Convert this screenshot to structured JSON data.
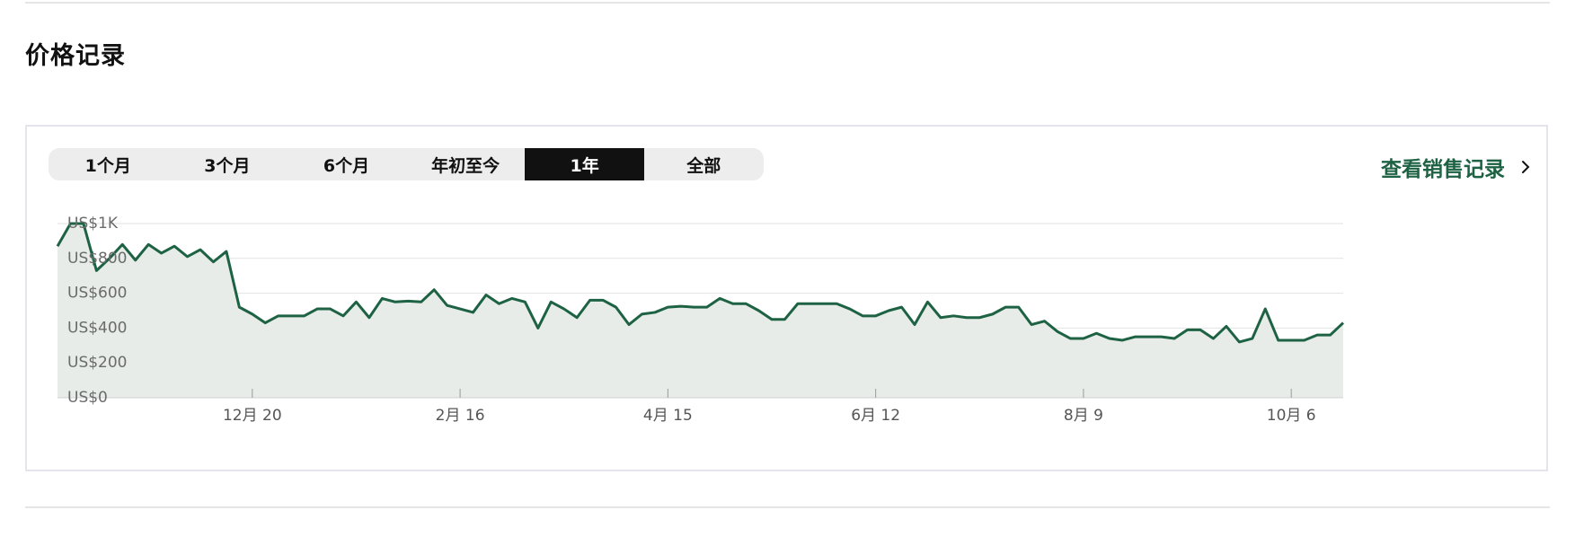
{
  "section": {
    "title": "价格记录"
  },
  "tabs": [
    "1个月",
    "3个月",
    "6个月",
    "年初至今",
    "1年",
    "全部"
  ],
  "active_tab": "1年",
  "sales_link": {
    "label": "查看销售记录",
    "icon": "chevron-right-icon"
  },
  "colors": {
    "line": "#1e6244",
    "area": "#e7ece9",
    "grid": "#e2e2e2",
    "link": "#1e6244",
    "active_tab_bg": "#111111"
  },
  "chart_data": {
    "type": "area",
    "y_ticks": [
      {
        "value": 0,
        "label": "US$0"
      },
      {
        "value": 200,
        "label": "US$200"
      },
      {
        "value": 400,
        "label": "US$400"
      },
      {
        "value": 600,
        "label": "US$600"
      },
      {
        "value": 800,
        "label": "US$800"
      },
      {
        "value": 1000,
        "label": "US$1K"
      }
    ],
    "ylim": [
      0,
      1000
    ],
    "x_ticks": [
      {
        "index": 15,
        "label": "12月 20"
      },
      {
        "index": 31,
        "label": "2月 16"
      },
      {
        "index": 47,
        "label": "4月 15"
      },
      {
        "index": 63,
        "label": "6月 12"
      },
      {
        "index": 79,
        "label": "8月 9"
      },
      {
        "index": 95,
        "label": "10月 6"
      }
    ],
    "xlim": [
      0,
      100
    ],
    "grid": true,
    "values": [
      870,
      1000,
      1000,
      730,
      800,
      880,
      790,
      880,
      830,
      870,
      810,
      850,
      780,
      840,
      520,
      480,
      430,
      470,
      470,
      470,
      510,
      510,
      470,
      550,
      460,
      570,
      550,
      555,
      550,
      620,
      530,
      510,
      490,
      590,
      540,
      570,
      550,
      400,
      550,
      510,
      460,
      560,
      560,
      520,
      420,
      480,
      490,
      520,
      525,
      520,
      520,
      570,
      540,
      540,
      500,
      450,
      450,
      540,
      540,
      540,
      540,
      510,
      470,
      470,
      500,
      520,
      420,
      550,
      460,
      470,
      460,
      460,
      480,
      520,
      520,
      420,
      440,
      380,
      340,
      340,
      370,
      340,
      330,
      350,
      350,
      350,
      340,
      390,
      390,
      340,
      410,
      320,
      340,
      510,
      330,
      330,
      330,
      360,
      360,
      430
    ]
  }
}
